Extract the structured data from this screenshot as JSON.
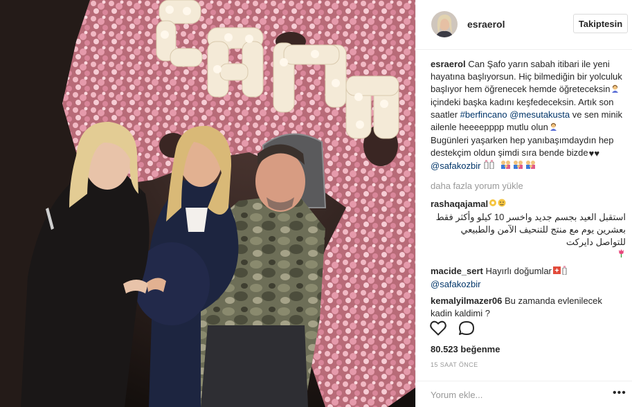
{
  "photo": {
    "alt": ""
  },
  "header": {
    "username": "esraerol",
    "follow_label": "Takiptesin"
  },
  "caption": {
    "username": "esraerol",
    "text_1": "Can Şafo yarın sabah itibari ile yeni hayatına başlıyorsun. Hiç bilmediğin bir yolculuk başlıyor hem öğrenecek hemde öğreteceksin",
    "text_2": " içindeki başka kadını keşfedeceksin. Artık son saatler ",
    "hashtag": "#berfincano",
    "mention_1": "@mesutakusta",
    "text_3": " ve sen minik ailenle heeeepppp mutlu olun",
    "text_4": "Bugünleri yaşarken hep yanıbaşımdaydın hep destekçim oldun şimdi sıra bende bizde",
    "mention_2": "@safakozbir"
  },
  "load_more": "daha fazla yorum yükle",
  "comments": [
    {
      "username": "rashaqajamal",
      "text": "استقبل العيد بجسم جديد واخسر 10 كيلو وأكثر فقط بعشرين يوم مع منتج للتنحيف الآمن والطبيعي للتواصل دايركت"
    },
    {
      "username": "macide_sert",
      "text": "Hayırlı doğumlar",
      "mention": "@safakozbir"
    },
    {
      "username": "kemalyilmazer06",
      "text": "Bu zamanda evlenilecek kadin kaldimi ?"
    }
  ],
  "likes": "80.523 beğenme",
  "time_ago": "15 SAAT ÖNCE",
  "add_comment_placeholder": "Yorum ekle...",
  "more_options": "•••",
  "colors": {
    "link": "#003569",
    "muted": "#999999",
    "border": "#efefef",
    "text": "#262626"
  },
  "icons": [
    "heart-icon",
    "comment-icon",
    "more-options-icon"
  ]
}
